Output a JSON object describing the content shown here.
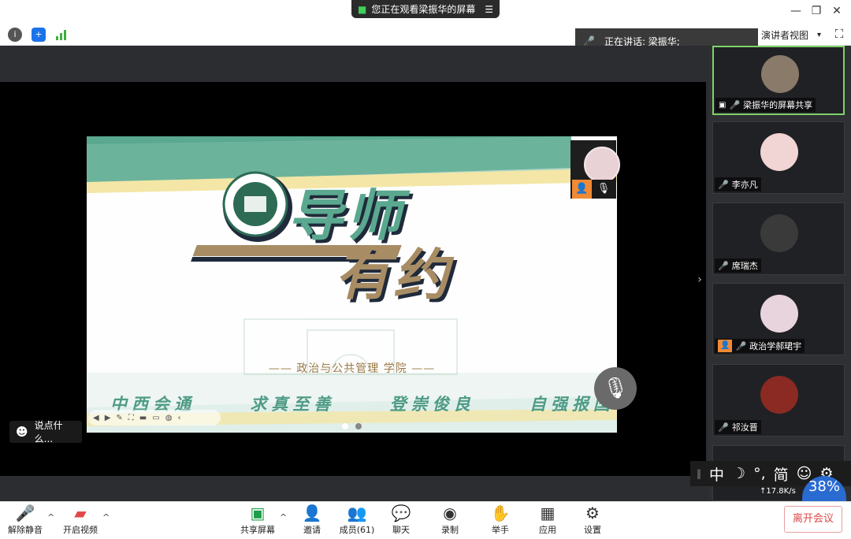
{
  "titlebar": {
    "viewing_label": "您正在观看梁振华的屏幕",
    "minimize": "—",
    "restore": "❐",
    "close": "✕"
  },
  "infobar": {
    "speaking_label": "正在讲话: 梁振华;",
    "view_mode": "演讲者视图",
    "view_mode_caret": "▾",
    "fullscreen": "⛶"
  },
  "slide": {
    "title_line1": "导师",
    "title_line2": "有约",
    "school": "—— 政治与公共管理 学院 ——",
    "motto": [
      "中西会通",
      "求真至善",
      "登崇俊良",
      "自强报国"
    ],
    "colors": {
      "teal": "#5aa88f",
      "gold": "#a88c64",
      "yellow": "#f3e6a6"
    }
  },
  "chat": {
    "placeholder": "说点什么..."
  },
  "participants": [
    {
      "name": "梁振华的屏幕共享",
      "state": "sharing",
      "avatar_color": "#8a7a6a"
    },
    {
      "name": "李亦凡",
      "state": "muted",
      "avatar_color": "#f1d4d4"
    },
    {
      "name": "席瑞杰",
      "state": "muted",
      "avatar_color": "#3a3a3a"
    },
    {
      "name": "政治学郝珺宇",
      "state": "host-muted",
      "avatar_color": "#e8d4dc"
    },
    {
      "name": "祁汝晋",
      "state": "muted",
      "avatar_color": "#8a2a22"
    }
  ],
  "ime": {
    "items": [
      "中",
      "☽",
      "°,",
      "简",
      "☺",
      "⚙"
    ]
  },
  "network": {
    "speed": "↑17.8K/s",
    "percent": "38%"
  },
  "toolbar": {
    "unmute": "解除静音",
    "start_video": "开启视频",
    "share_screen": "共享屏幕",
    "invite": "邀请",
    "members": "成员(61)",
    "chat": "聊天",
    "record": "录制",
    "raise_hand": "举手",
    "apps": "应用",
    "settings": "设置",
    "leave": "离开会议"
  }
}
